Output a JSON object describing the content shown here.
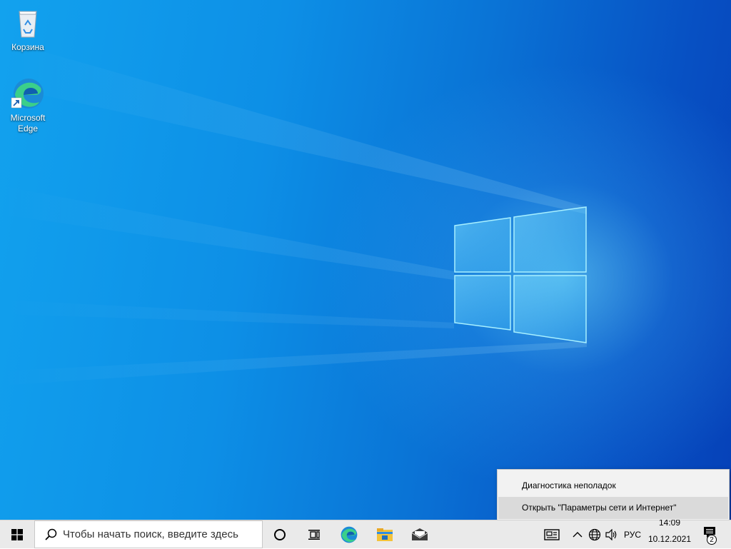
{
  "desktop": {
    "icons": [
      {
        "label": "Корзина",
        "icon": "recycle-bin-icon"
      },
      {
        "label": "Microsoft Edge",
        "icon": "edge-icon"
      }
    ]
  },
  "context_menu": {
    "items": [
      {
        "label": "Диагностика неполадок"
      },
      {
        "label": "Открыть \"Параметры сети и Интернет\""
      }
    ],
    "highlighted_index": 1
  },
  "taskbar": {
    "search_placeholder": "Чтобы начать поиск, введите здесь",
    "pinned": [
      {
        "icon": "cortana-icon"
      },
      {
        "icon": "task-view-icon"
      },
      {
        "icon": "edge-icon"
      },
      {
        "icon": "file-explorer-icon"
      },
      {
        "icon": "mail-icon"
      }
    ],
    "tray": {
      "language": "РУС",
      "time": "14:09",
      "date": "10.12.2021",
      "notification_count": "2"
    }
  },
  "colors": {
    "accent": "#0078d7",
    "taskbar_bg": "#eaeaea",
    "menu_bg": "#f2f2f2",
    "menu_highlight": "#dadada"
  }
}
